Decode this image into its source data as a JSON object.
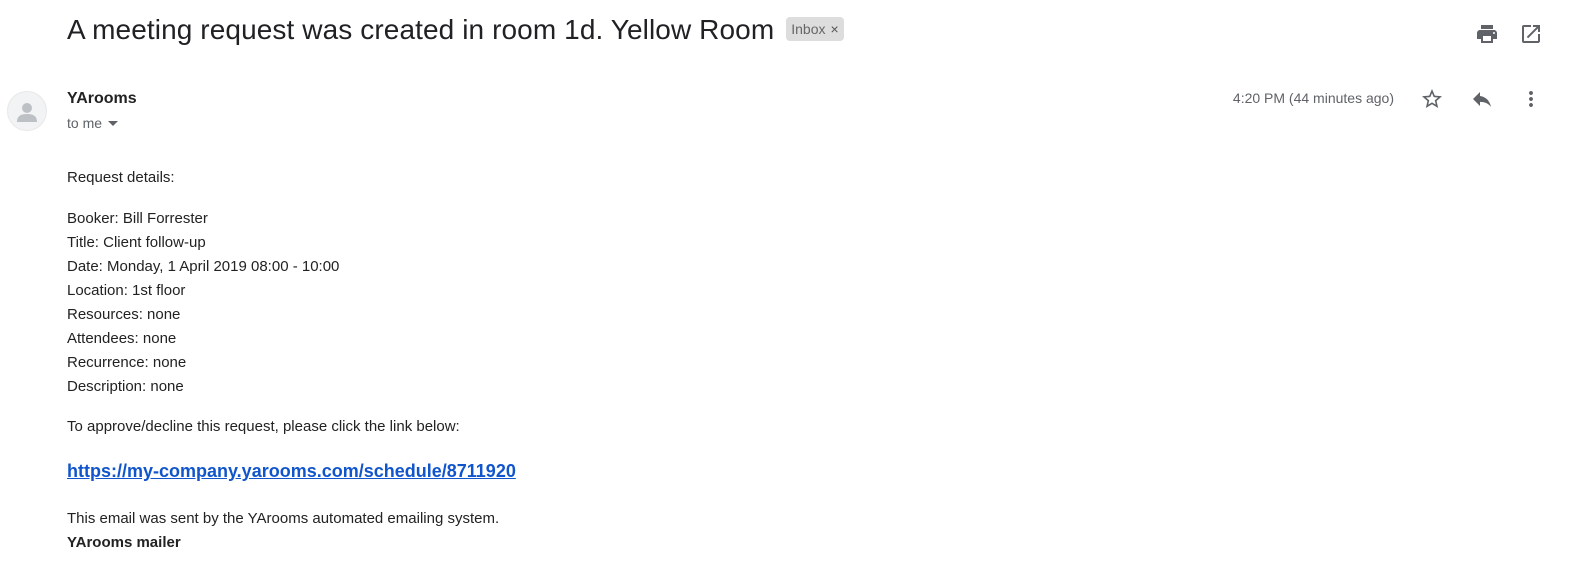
{
  "email": {
    "subject": "A meeting request was created in room 1d. Yellow Room",
    "label": "Inbox",
    "label_remove": "×",
    "sender": "YArooms",
    "recipient": "to me",
    "timestamp": "4:20 PM (44 minutes ago)"
  },
  "icons": {
    "print": "print-icon",
    "open_new_window": "open-in-new-window-icon",
    "avatar": "avatar-icon",
    "star": "star-icon",
    "reply": "reply-icon",
    "more": "more-vertical-icon",
    "caret": "chevron-down-icon"
  },
  "body": {
    "intro": "Request details:",
    "details": [
      "Booker: Bill Forrester",
      "Title: Client follow-up",
      "Date: Monday, 1 April 2019 08:00 - 10:00",
      "Location: 1st floor",
      "Resources: none",
      "Attendees: none",
      "Recurrence: none",
      "Description: none"
    ],
    "instruction": "To approve/decline this request, please click the link below:",
    "link": "https://my-company.yarooms.com/schedule/8711920",
    "footer": "This email was sent by the YArooms automated emailing system.",
    "signature": "YArooms mailer"
  },
  "colors": {
    "link": "#1155cc",
    "label_bg": "#dddddd",
    "icon": "#5f6368"
  }
}
